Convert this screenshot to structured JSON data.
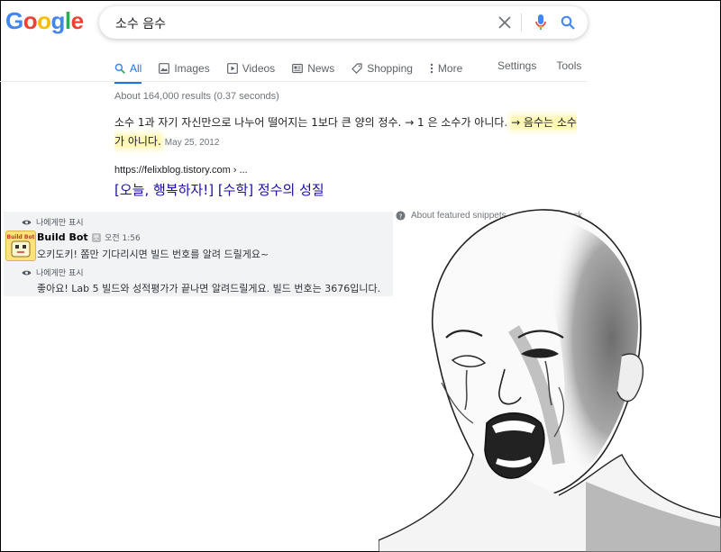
{
  "logo": {
    "letters": [
      "G",
      "o",
      "o",
      "g",
      "l",
      "e"
    ],
    "colors": [
      "#4285f4",
      "#ea4335",
      "#fbbc05",
      "#4285f4",
      "#34a853",
      "#ea4335"
    ]
  },
  "search": {
    "query": "소수 음수"
  },
  "tabs": [
    {
      "label": "All",
      "icon": "search-icon",
      "active": true
    },
    {
      "label": "Images",
      "icon": "image-icon"
    },
    {
      "label": "Videos",
      "icon": "video-icon"
    },
    {
      "label": "News",
      "icon": "news-icon"
    },
    {
      "label": "Shopping",
      "icon": "tag-icon"
    },
    {
      "label": "More",
      "icon": "more-vert-icon"
    }
  ],
  "tools": {
    "settings": "Settings",
    "tools": "Tools"
  },
  "stats": "About 164,000 results (0.37 seconds)",
  "snippet": {
    "part1": "소수 1과 자기 자신만으로 나누어 떨어지는 1보다 큰 양의 정수. → 1 은 소수가 아니다. ",
    "highlight": "→ 음수는 소수가 아니다.",
    "date": "May 25, 2012"
  },
  "result": {
    "cite": "https://felixblog.tistory.com › ...",
    "title": "[오늘, 행복하자!] [수학] 정수의 성질"
  },
  "featured_footer": {
    "about": "About featured snippets",
    "dot": "•",
    "feedback": "Feedback"
  },
  "chat": {
    "ephemeral_label": "나에게만 표시",
    "author": "Build Bot",
    "bot_tag": "봇",
    "time": "오전 1:56",
    "avatar_text": "Build Bot",
    "message1": "오키도키! 쫌만 기다리시면 빌드 번호를 알려 드릴게요~",
    "message2": "좋아요! Lab 5 빌드와 성적평가가 끝나면 알려드릴게요. 빌드 번호는 3676입니다."
  },
  "colors": {
    "link": "#1a0dab",
    "accent": "#1a73e8",
    "highlight": "#fff8b8"
  }
}
